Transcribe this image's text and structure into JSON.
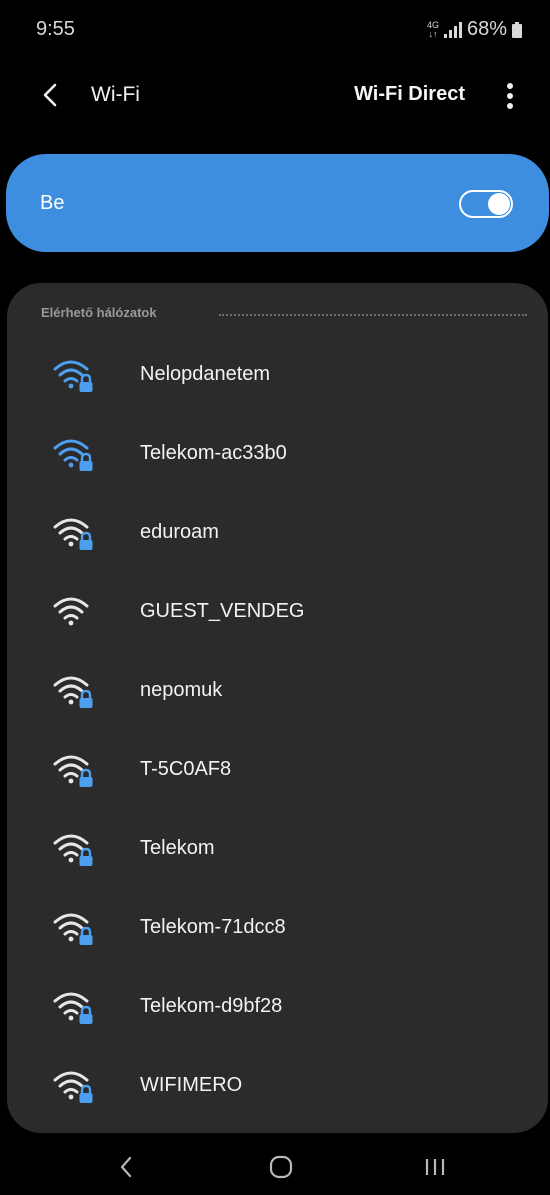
{
  "status_bar": {
    "time": "9:55",
    "network_top": "4G",
    "network_bottom": "↓↑",
    "battery": "68%"
  },
  "header": {
    "title": "Wi-Fi",
    "wifi_direct_label": "Wi-Fi Direct",
    "back_icon": "chevron-left-icon",
    "more_icon": "more-vertical-icon"
  },
  "toggle": {
    "label": "Be",
    "state": "on",
    "accent_color": "#3e8ee0"
  },
  "networks": {
    "section_title": "Elérhető hálózatok",
    "items": [
      {
        "name": "Nelopdanetem",
        "secured": true,
        "signal_color": "blue"
      },
      {
        "name": "Telekom-ac33b0",
        "secured": true,
        "signal_color": "blue"
      },
      {
        "name": "eduroam",
        "secured": true,
        "signal_color": "white"
      },
      {
        "name": "GUEST_VENDEG",
        "secured": false,
        "signal_color": "white"
      },
      {
        "name": "nepomuk",
        "secured": true,
        "signal_color": "white"
      },
      {
        "name": "T-5C0AF8",
        "secured": true,
        "signal_color": "white"
      },
      {
        "name": "Telekom",
        "secured": true,
        "signal_color": "white"
      },
      {
        "name": "Telekom-71dcc8",
        "secured": true,
        "signal_color": "white"
      },
      {
        "name": "Telekom-d9bf28",
        "secured": true,
        "signal_color": "white"
      },
      {
        "name": "WIFIMERO",
        "secured": true,
        "signal_color": "white"
      }
    ]
  },
  "nav_bar": {
    "back_icon": "nav-back-icon",
    "home_icon": "nav-home-icon",
    "recents_icon": "nav-recents-icon"
  }
}
